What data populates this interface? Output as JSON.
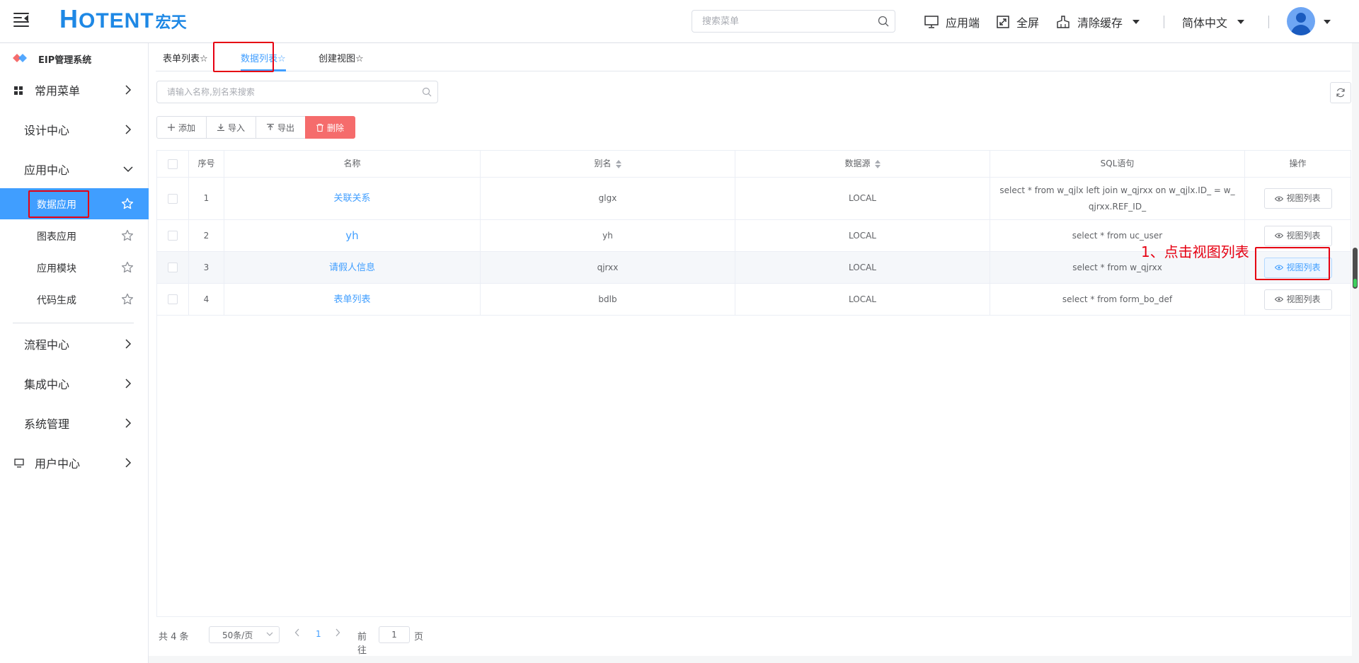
{
  "header": {
    "logo_en": "OTENT",
    "logo_first": "H",
    "logo_cn": "宏天",
    "search_placeholder": "搜索菜单",
    "app_client": "应用端",
    "fullscreen": "全屏",
    "clear_cache": "清除缓存",
    "language": "简体中文"
  },
  "sidebar": {
    "brand": "EIP管理系统",
    "items": {
      "common": "常用菜单",
      "design": "设计中心",
      "app": "应用中心",
      "process": "流程中心",
      "integration": "集成中心",
      "system": "系统管理",
      "user": "用户中心"
    },
    "sub_items": [
      "数据应用",
      "图表应用",
      "应用模块",
      "代码生成"
    ]
  },
  "tabs": [
    "表单列表",
    "数据列表",
    "创建视图"
  ],
  "toolbar": {
    "search_placeholder": "请输入名称,别名来搜索",
    "add": "添加",
    "import": "导入",
    "export": "导出",
    "delete": "删除"
  },
  "table": {
    "headers": {
      "index": "序号",
      "name": "名称",
      "alias": "别名",
      "datasource": "数据源",
      "sql": "SQL语句",
      "operation": "操作"
    },
    "rows": [
      {
        "index": "1",
        "name": "关联关系",
        "alias": "glgx",
        "datasource": "LOCAL",
        "sql": "select * from w_qjlx left join w_qjrxx on w_qjlx.ID_ = w_qjrxx.REF_ID_",
        "action": "视图列表"
      },
      {
        "index": "2",
        "name": "yh",
        "alias": "yh",
        "datasource": "LOCAL",
        "sql": "select * from uc_user",
        "action": "视图列表"
      },
      {
        "index": "3",
        "name": "请假人信息",
        "alias": "qjrxx",
        "datasource": "LOCAL",
        "sql": "select * from w_qjrxx",
        "action": "视图列表"
      },
      {
        "index": "4",
        "name": "表单列表",
        "alias": "bdlb",
        "datasource": "LOCAL",
        "sql": "select * from form_bo_def",
        "action": "视图列表"
      }
    ]
  },
  "annotation": "1、点击视图列表",
  "pagination": {
    "total": "共 4 条",
    "page_size": "50条/页",
    "current_page": "1",
    "goto_label": "前往",
    "goto_value": "1",
    "page_unit": "页"
  },
  "colors": {
    "accent": "#409eff",
    "danger": "#f56c6c",
    "annotation_red": "#e60012",
    "logo_blue": "#1e88e5"
  }
}
